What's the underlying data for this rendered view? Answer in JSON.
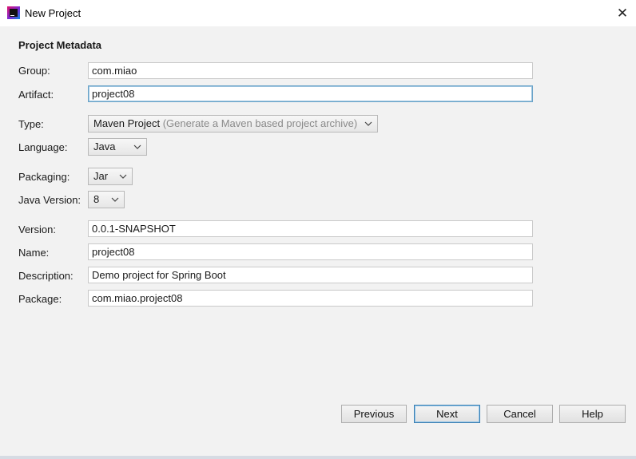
{
  "window": {
    "title": "New Project",
    "close_icon": "close-icon",
    "app_icon": "intellij-idea-icon"
  },
  "form": {
    "section_title": "Project Metadata",
    "group": {
      "label": "Group:",
      "value": "com.miao"
    },
    "artifact": {
      "label": "Artifact:",
      "value": "project08"
    },
    "type": {
      "label": "Type:",
      "value": "Maven Project",
      "hint": "(Generate a Maven based project archive)"
    },
    "language": {
      "label": "Language:",
      "value": "Java"
    },
    "packaging": {
      "label": "Packaging:",
      "value": "Jar"
    },
    "java_version": {
      "label": "Java Version:",
      "value": "8"
    },
    "version": {
      "label": "Version:",
      "value": "0.0.1-SNAPSHOT"
    },
    "name": {
      "label": "Name:",
      "value": "project08"
    },
    "description": {
      "label": "Description:",
      "value": "Demo project for Spring Boot"
    },
    "package": {
      "label": "Package:",
      "value": "com.miao.project08"
    }
  },
  "buttons": {
    "previous": "Previous",
    "next": "Next",
    "cancel": "Cancel",
    "help": "Help"
  },
  "colors": {
    "focus_border": "#6aa3c8",
    "primary_button_border": "#3c7fb1"
  }
}
